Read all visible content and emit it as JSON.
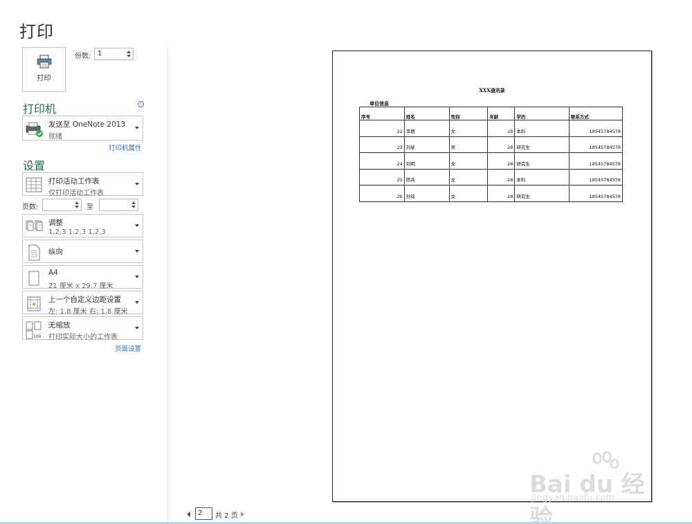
{
  "page_title": "打印",
  "print_button": {
    "label": "打印",
    "icon": "printer-icon"
  },
  "copies": {
    "label": "份数:",
    "value": "1"
  },
  "printer": {
    "heading": "打印机",
    "info_icon": "info-icon",
    "name": "发送至 OneNote 2013",
    "status": "就绪",
    "properties_link": "打印机属性"
  },
  "settings": {
    "heading": "设置",
    "scope": {
      "title": "打印活动工作表",
      "subtitle": "仅打印活动工作表"
    },
    "pages": {
      "label": "页数:",
      "from": "",
      "to_label": "至",
      "to": ""
    },
    "collate": {
      "title": "调整",
      "subtitle": "1,2,3    1,2,3    1,2,3"
    },
    "orientation": {
      "title": "纵向"
    },
    "paper": {
      "title": "A4",
      "subtitle": "21 厘米 x 29.7 厘米"
    },
    "margins": {
      "title": "上一个自定义边距设置",
      "subtitle": "左: 1.8 厘米    右: 1.8 厘米"
    },
    "scaling": {
      "title": "无缩放",
      "subtitle": "打印实际大小的工作表"
    },
    "page_setup_link": "页面设置"
  },
  "preview": {
    "doc_title": "XXX通讯录",
    "unit_info": "单位信息",
    "columns": [
      "序号",
      "姓名",
      "性别",
      "年龄",
      "学历",
      "联系方式"
    ],
    "rows": [
      [
        "22",
        "李丽",
        "女",
        "28",
        "本科",
        "18545784578"
      ],
      [
        "23",
        "刘星",
        "男",
        "28",
        "研究生",
        "18545784578"
      ],
      [
        "24",
        "刘明",
        "女",
        "28",
        "研究生",
        "18545784578"
      ],
      [
        "25",
        "陈兵",
        "女",
        "28",
        "本科",
        "18545784578"
      ],
      [
        "26",
        "孙铭",
        "女",
        "28",
        "研究生",
        "18545784578"
      ]
    ]
  },
  "navigation": {
    "current_page": "2",
    "total_label": "共 2 页"
  },
  "watermark": {
    "brand": "Bai du 经验",
    "url": "jingyan.baidu.com"
  },
  "colors": {
    "accent_green": "#217346",
    "link_blue": "#2e75b6"
  }
}
